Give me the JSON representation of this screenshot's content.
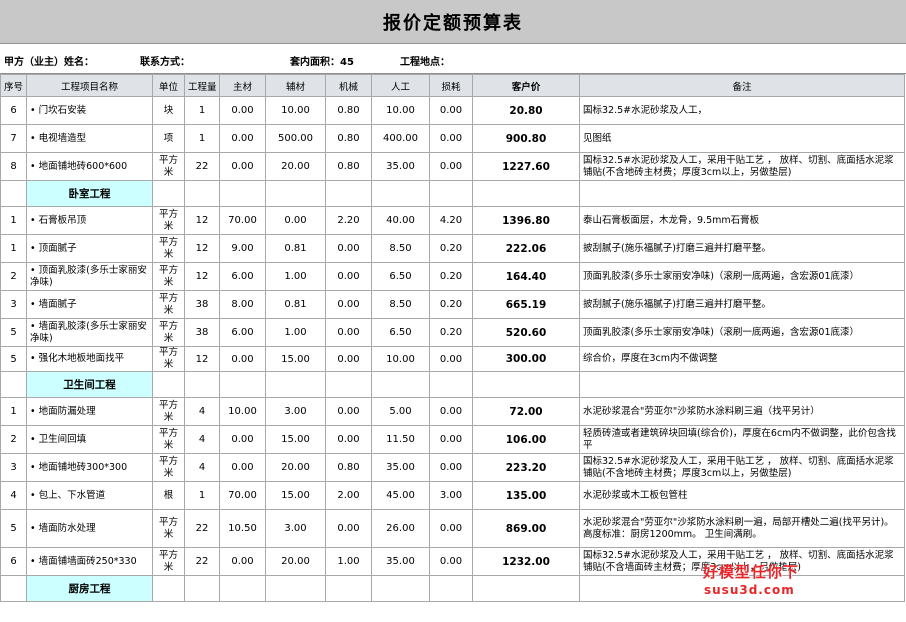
{
  "title": "报价定额预算表",
  "info": {
    "owner_label": "甲方（业主）姓名：",
    "contact_label": "联系方式：",
    "area_label": "套内面积：45",
    "location_label": "工程地点："
  },
  "headers": [
    "序号",
    "工程项目名称",
    "单位",
    "工程量",
    "主材",
    "辅材",
    "机械",
    "人工",
    "损耗",
    "客户价",
    "备注"
  ],
  "rows": [
    {
      "type": "item",
      "no": "6",
      "name": "• 门坎石安装",
      "unit": "块",
      "qty": "1",
      "main": "0.00",
      "aux": "10.00",
      "mech": "0.80",
      "labor": "10.00",
      "loss": "0.00",
      "price": "20.80",
      "note": "国标32.5#水泥砂浆及人工，"
    },
    {
      "type": "item",
      "no": "7",
      "name": "• 电视墙造型",
      "unit": "项",
      "qty": "1",
      "main": "0.00",
      "aux": "500.00",
      "mech": "0.80",
      "labor": "400.00",
      "loss": "0.00",
      "price": "900.80",
      "note": "见图纸"
    },
    {
      "type": "item",
      "no": "8",
      "name": "• 地面铺地砖600*600",
      "unit": "平方米",
      "qty": "22",
      "main": "0.00",
      "aux": "20.00",
      "mech": "0.80",
      "labor": "35.00",
      "loss": "0.00",
      "price": "1227.60",
      "note": "国标32.5#水泥砂浆及人工，采用干贴工艺 ， 放样、切割、底面括水泥浆铺贴(不含地砖主材费；厚度3cm以上，另做垫层)"
    },
    {
      "type": "section",
      "name": "卧室工程"
    },
    {
      "type": "item",
      "no": "1",
      "name": "• 石膏板吊顶",
      "unit": "平方米",
      "qty": "12",
      "main": "70.00",
      "aux": "0.00",
      "mech": "2.20",
      "labor": "40.00",
      "loss": "4.20",
      "price": "1396.80",
      "note": "泰山石膏板面层，木龙骨，9.5mm石膏板"
    },
    {
      "type": "item",
      "no": "1",
      "name": "• 顶面腻子",
      "unit": "平方米",
      "qty": "12",
      "main": "9.00",
      "aux": "0.81",
      "mech": "0.00",
      "labor": "8.50",
      "loss": "0.20",
      "price": "222.06",
      "note": "披刮腻子(施乐福腻子)打磨三遍并打磨平整。"
    },
    {
      "type": "item",
      "no": "2",
      "name": "• 顶面乳胶漆(多乐士家丽安净味)",
      "unit": "平方米",
      "qty": "12",
      "main": "6.00",
      "aux": "1.00",
      "mech": "0.00",
      "labor": "6.50",
      "loss": "0.20",
      "price": "164.40",
      "note": "顶面乳胶漆(多乐士家丽安净味)（滚刷一底两遍，含宏源01底漆）"
    },
    {
      "type": "item",
      "no": "3",
      "name": "• 墙面腻子",
      "unit": "平方米",
      "qty": "38",
      "main": "8.00",
      "aux": "0.81",
      "mech": "0.00",
      "labor": "8.50",
      "loss": "0.20",
      "price": "665.19",
      "note": "披刮腻子(施乐福腻子)打磨三遍并打磨平整。"
    },
    {
      "type": "item",
      "no": "5",
      "name": "• 墙面乳胶漆(多乐士家丽安净味)",
      "unit": "平方米",
      "qty": "38",
      "main": "6.00",
      "aux": "1.00",
      "mech": "0.00",
      "labor": "6.50",
      "loss": "0.20",
      "price": "520.60",
      "note": "顶面乳胶漆(多乐士家丽安净味)（滚刷一底两遍，含宏源01底漆）"
    },
    {
      "type": "item",
      "no": "5",
      "name": "• 强化木地板地面找平",
      "unit": "平方米",
      "qty": "12",
      "main": "0.00",
      "aux": "15.00",
      "mech": "0.00",
      "labor": "10.00",
      "loss": "0.00",
      "price": "300.00",
      "note": "综合价，厚度在3cm内不做调整"
    },
    {
      "type": "section",
      "name": "卫生间工程"
    },
    {
      "type": "item",
      "no": "1",
      "name": "• 地面防漏处理",
      "unit": "平方米",
      "qty": "4",
      "main": "10.00",
      "aux": "3.00",
      "mech": "0.00",
      "labor": "5.00",
      "loss": "0.00",
      "price": "72.00",
      "note": "水泥砂浆混合\"劳亚尔\"沙浆防水涂料刷三遍（找平另计）"
    },
    {
      "type": "item",
      "no": "2",
      "name": "• 卫生间回填",
      "unit": "平方米",
      "qty": "4",
      "main": "0.00",
      "aux": "15.00",
      "mech": "0.00",
      "labor": "11.50",
      "loss": "0.00",
      "price": "106.00",
      "note": "轻质砖渣或者建筑碎块回填(综合价)，厚度在6cm内不做调整，此价包含找平"
    },
    {
      "type": "item",
      "no": "3",
      "name": "• 地面铺地砖300*300",
      "unit": "平方米",
      "qty": "4",
      "main": "0.00",
      "aux": "20.00",
      "mech": "0.80",
      "labor": "35.00",
      "loss": "0.00",
      "price": "223.20",
      "note": "国标32.5#水泥砂浆及人工，采用干贴工艺 ， 放样、切割、底面括水泥浆铺贴(不含地砖主材费；厚度3cm以上，另做垫层)"
    },
    {
      "type": "item",
      "no": "4",
      "name": "• 包上、下水管道",
      "unit": "根",
      "qty": "1",
      "main": "70.00",
      "aux": "15.00",
      "mech": "2.00",
      "labor": "45.00",
      "loss": "3.00",
      "price": "135.00",
      "note": "水泥砂浆或木工板包管柱"
    },
    {
      "type": "item",
      "no": "5",
      "name": "• 墙面防水处理",
      "unit": "平方米",
      "qty": "22",
      "main": "10.50",
      "aux": "3.00",
      "mech": "0.00",
      "labor": "26.00",
      "loss": "0.00",
      "price": "869.00",
      "note": "水泥砂浆混合\"劳亚尔\"沙浆防水涂料刷一遍，局部开槽处二遍(找平另计)。高度标准：厨房1200mm。  卫生间满刷。"
    },
    {
      "type": "item",
      "no": "6",
      "name": "• 墙面铺墙面砖250*330",
      "unit": "平方米",
      "qty": "22",
      "main": "0.00",
      "aux": "20.00",
      "mech": "1.00",
      "labor": "35.00",
      "loss": "0.00",
      "price": "1232.00",
      "note": "国标32.5#水泥砂浆及人工，采用干贴工艺 ， 放样、切割、底面括水泥浆铺贴(不含墙面砖主材费；厚度3cm以上，另做垫层)"
    },
    {
      "type": "section",
      "name": "厨房工程"
    }
  ],
  "watermark": {
    "line1": "好模型任你下",
    "line2": "susu3d.com"
  }
}
